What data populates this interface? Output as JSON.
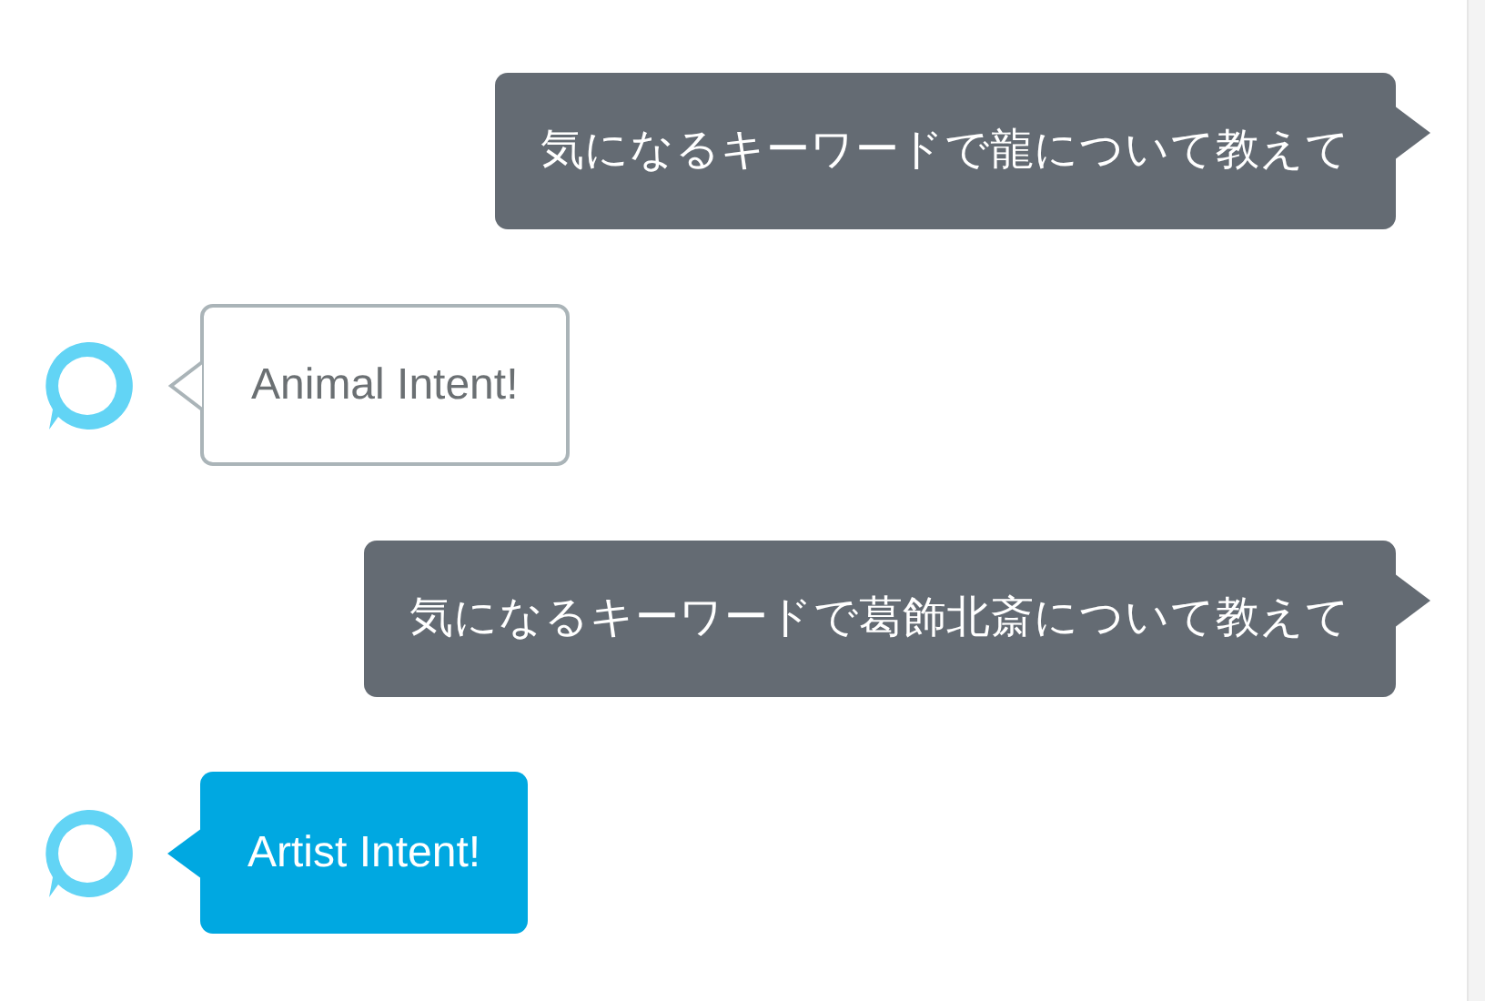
{
  "messages": [
    {
      "kind": "user",
      "text": "気になるキーワードで龍について教えて"
    },
    {
      "kind": "reply",
      "highlighted": false,
      "text": "Animal Intent!"
    },
    {
      "kind": "user",
      "text": "気になるキーワードで葛飾北斎について教えて"
    },
    {
      "kind": "reply",
      "highlighted": true,
      "text": "Artist Intent!"
    }
  ]
}
